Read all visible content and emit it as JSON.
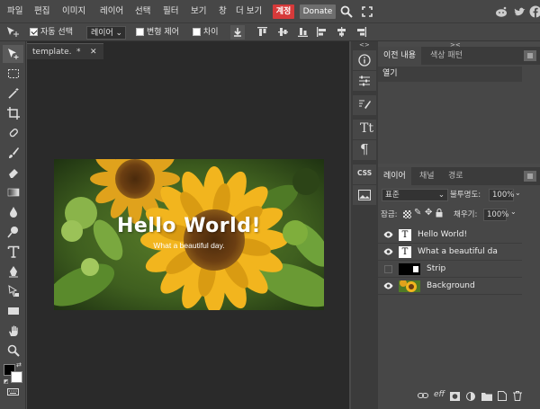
{
  "menubar": {
    "items": [
      "파일",
      "편집",
      "이미지",
      "레이어",
      "선택",
      "필터",
      "보기",
      "창",
      "더 보기"
    ],
    "account_label": "계정",
    "donate_label": "Donate"
  },
  "options": {
    "auto_select_label": "자동 선택",
    "layer_select_value": "레이어",
    "transform_label": "변형 제어",
    "diff_label": "차이"
  },
  "document": {
    "tab_name": "template.",
    "modified_mark": "*",
    "close_mark": "✕"
  },
  "canvas_image": {
    "title_text": "Hello World!",
    "subtitle_text": "What a beautiful day."
  },
  "mini_panel": {
    "css_label": "CSS"
  },
  "history": {
    "tabs": [
      "이전 내용",
      "색상 패턴"
    ],
    "items": [
      "열기"
    ]
  },
  "layers": {
    "tabs": [
      "레이어",
      "채널",
      "경로"
    ],
    "blend_mode": "표준",
    "opacity_label": "불투명도:",
    "opacity_value": "100%",
    "lock_label": "잠금:",
    "fill_label": "채우기:",
    "fill_value": "100%",
    "items": [
      {
        "name": "Hello World!",
        "visible": true,
        "thumb": "T"
      },
      {
        "name": "What a beautiful da",
        "visible": true,
        "thumb": "T"
      },
      {
        "name": "Strip",
        "visible": false,
        "thumb": ""
      },
      {
        "name": "Background",
        "visible": true,
        "thumb": ""
      }
    ],
    "footer_fx": "eff"
  },
  "colors": {
    "account": "#d63a3a",
    "foreground": "#000000",
    "background": "#ffffff"
  }
}
